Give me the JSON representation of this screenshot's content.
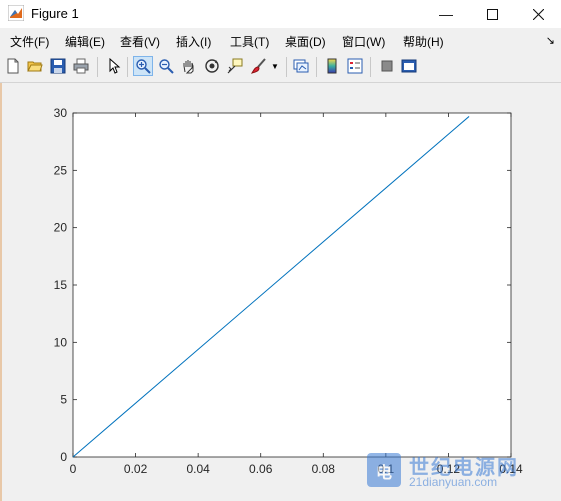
{
  "window": {
    "title": "Figure 1"
  },
  "menu": {
    "items": [
      "文件(F)",
      "编辑(E)",
      "查看(V)",
      "插入(I)",
      "工具(T)",
      "桌面(D)",
      "窗口(W)",
      "帮助(H)"
    ]
  },
  "toolbar": {
    "icons": [
      "new-file-icon",
      "open-folder-icon",
      "save-icon",
      "print-icon",
      "select-arrow-icon",
      "zoom-in-icon",
      "zoom-out-icon",
      "pan-hand-icon",
      "rotate-3d-icon",
      "data-cursor-icon",
      "brush-icon",
      "link-plot-icon",
      "colorbar-icon",
      "legend-icon",
      "hide-plot-tools-icon",
      "show-plot-tools-icon"
    ]
  },
  "watermark": {
    "line1": "世纪电源网",
    "line2": "21dianyuan.com"
  },
  "chart_data": {
    "type": "line",
    "title": "",
    "xlabel": "",
    "ylabel": "",
    "xlim": [
      0,
      0.14
    ],
    "ylim": [
      0,
      30
    ],
    "xticks": [
      "0",
      "0.02",
      "0.04",
      "0.06",
      "0.08",
      "0.1",
      "0.12",
      "0.14"
    ],
    "yticks": [
      "0",
      "5",
      "10",
      "15",
      "20",
      "25",
      "30"
    ],
    "grid": false,
    "series": [
      {
        "x": [
          0,
          0.1266
        ],
        "y": [
          0,
          29.7
        ],
        "color": "#0072bd"
      }
    ]
  }
}
